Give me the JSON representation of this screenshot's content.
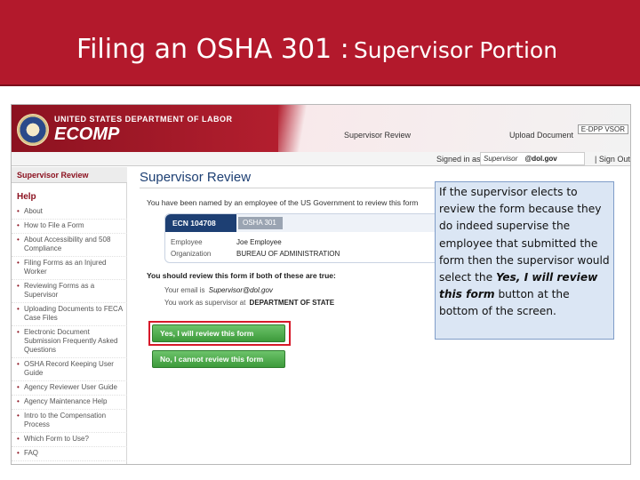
{
  "slide": {
    "title_main": "Filing an OSHA 301 :",
    "title_sub": "Supervisor Portion"
  },
  "app": {
    "department": "UNITED STATES DEPARTMENT OF LABOR",
    "name": "ECOMP",
    "nav": {
      "supervisor_review": "Supervisor Review",
      "upload_document": "Upload Document",
      "help": "E-DPP VSOR"
    },
    "user_strip": {
      "signed_in": "Signed in as",
      "user_name": "Supervisor",
      "user_domain": "@dol.gov",
      "sign_out": "| Sign Out"
    }
  },
  "sidebar": {
    "header": "Supervisor Review",
    "help_heading": "Help",
    "items": [
      "About",
      "How to File a Form",
      "About Accessibility and 508 Compliance",
      "Filing Forms as an Injured Worker",
      "Reviewing Forms as a Supervisor",
      "Uploading Documents to FECA Case Files",
      "Electronic Document Submission Frequently Asked Questions",
      "OSHA Record Keeping User Guide",
      "Agency Reviewer User Guide",
      "Agency Maintenance Help",
      "Intro to the Compensation Process",
      "Which Form to Use?",
      "FAQ"
    ]
  },
  "main": {
    "page_title": "Supervisor Review",
    "intro": "You have been named by an employee of the US Government to review this form",
    "case": {
      "ecn": "ECN 104708",
      "form": "OSHA 301",
      "employee_label": "Employee",
      "employee_value": "Joe Employee",
      "org_label": "Organization",
      "org_value": "BUREAU OF ADMINISTRATION"
    },
    "should_review": "You should review this form if both of these are true:",
    "criteria": {
      "email_label": "Your email is",
      "email_value": "Supervisor@dol.gov",
      "agency_label": "You work as supervisor at",
      "agency_value": "DEPARTMENT OF STATE"
    },
    "buttons": {
      "yes": "Yes, I will review this form",
      "no": "No, I cannot review this form"
    }
  },
  "callout": {
    "text": "If the supervisor elects to review the form because they do indeed supervise the employee that submitted the form then the supervisor would select the",
    "emphasis": "Yes, I will review this form",
    "tail": "button at the bottom of the screen."
  },
  "colors": {
    "title_band": "#b3192c",
    "button_green": "#3d9a3b",
    "highlight_red": "#d7192a",
    "callout_bg": "#dbe6f4"
  }
}
